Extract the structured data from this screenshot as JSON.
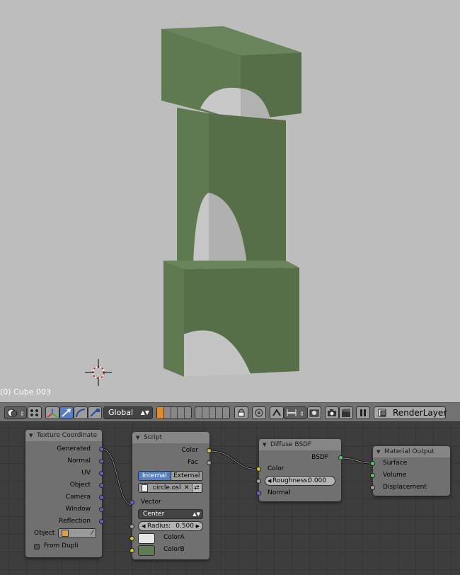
{
  "viewport": {
    "object_label": "(0) Cube.003",
    "colors": {
      "background": "#bdbdbd",
      "object_front": "#607a52",
      "object_side": "#556e48",
      "object_top": "#6a845b",
      "cutout": "#c9c9c9"
    }
  },
  "header": {
    "orientation_value": "Global",
    "render_layer": "RenderLayer",
    "icons": [
      "viewport-shading-icon",
      "pivot-icon",
      "manipulator-icon",
      "translate-icon",
      "rotate-icon",
      "scale-icon",
      "layers-icon",
      "lock-icon",
      "onion-icon",
      "snap-icon",
      "snap-element-icon",
      "render-icon",
      "clapper-icon",
      "pause-icon",
      "render-layer-icon"
    ]
  },
  "nodes": {
    "texture_coordinate": {
      "title": "Texture Coordinate",
      "outputs": [
        "Generated",
        "Normal",
        "UV",
        "Object",
        "Camera",
        "Window",
        "Reflection"
      ],
      "object_label": "Object",
      "from_dupli_label": "From Dupli"
    },
    "script": {
      "title": "Script",
      "outputs": [
        "Color",
        "Fac"
      ],
      "mode_internal": "Internal",
      "mode_external": "External",
      "file": "circle.osl",
      "vector_label": "Vector",
      "dropdown_value": "Center",
      "radius_label": "Radius:",
      "radius_value": "0.500",
      "color_a_label": "ColorA",
      "color_b_label": "ColorB",
      "color_a": "#e6e6e6",
      "color_b": "#607a52"
    },
    "diffuse": {
      "title": "Diffuse BSDF",
      "output": "BSDF",
      "color_label": "Color",
      "roughness_label": "Roughness:",
      "roughness_value": "0.000",
      "normal_label": "Normal"
    },
    "material_output": {
      "title": "Material Output",
      "surface": "Surface",
      "volume": "Volume",
      "displacement": "Displacement"
    }
  },
  "socket_colors": {
    "vector": "#6363c7",
    "color": "#c7c729",
    "float": "#a1a1a1",
    "shader": "#63c763"
  }
}
